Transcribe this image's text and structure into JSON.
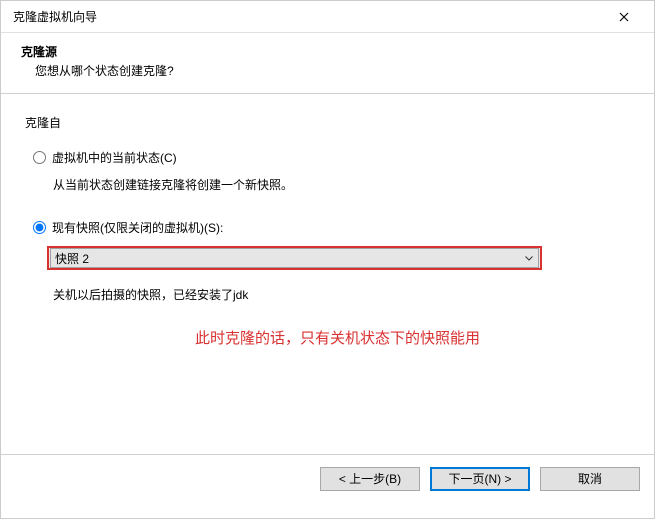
{
  "window": {
    "title": "克隆虚拟机向导"
  },
  "header": {
    "title": "克隆源",
    "subtitle": "您想从哪个状态创建克隆?"
  },
  "content": {
    "group_label": "克隆自",
    "option_current": {
      "label": "虚拟机中的当前状态(C)",
      "desc": "从当前状态创建链接克隆将创建一个新快照。"
    },
    "option_snapshot": {
      "label": "现有快照(仅限关闭的虚拟机)(S):",
      "selected": "快照 2",
      "desc": "关机以后拍摄的快照，已经安装了jdk"
    },
    "annotation": "此时克隆的话，只有关机状态下的快照能用"
  },
  "footer": {
    "back": "< 上一步(B)",
    "next": "下一页(N) >",
    "cancel": "取消"
  }
}
